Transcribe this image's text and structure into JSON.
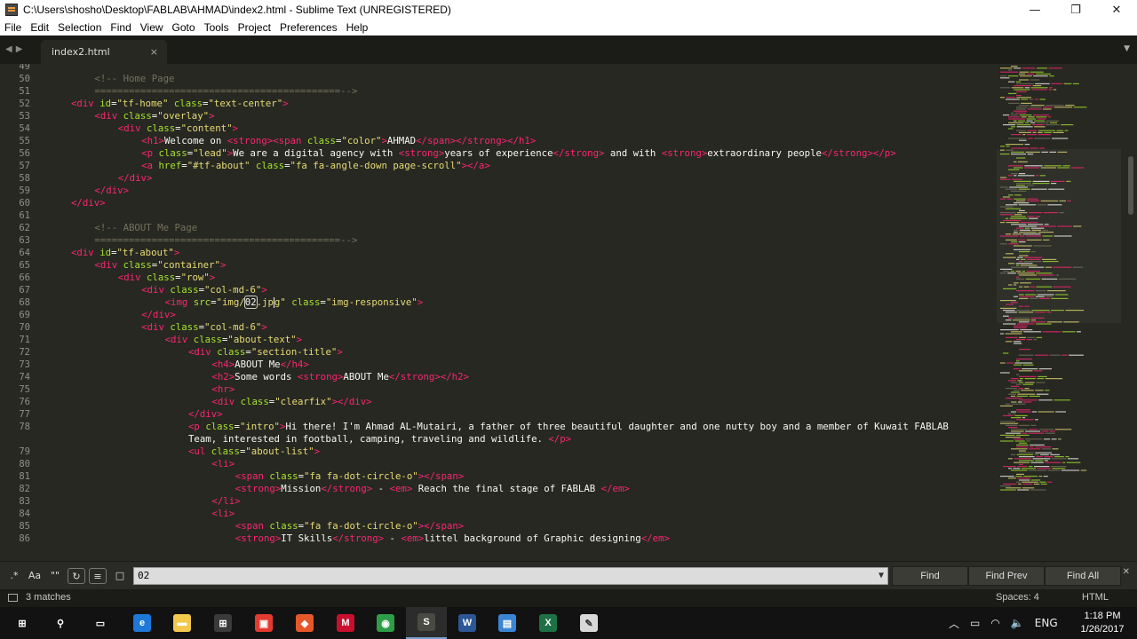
{
  "window": {
    "title": "C:\\Users\\shosho\\Desktop\\FABLAB\\AHMAD\\index2.html - Sublime Text (UNREGISTERED)",
    "controls": {
      "minimize": "—",
      "maximize": "❐",
      "close": "✕"
    }
  },
  "menu": [
    "File",
    "Edit",
    "Selection",
    "Find",
    "View",
    "Goto",
    "Tools",
    "Project",
    "Preferences",
    "Help"
  ],
  "tabs": [
    {
      "label": "index2.html",
      "close": "×",
      "active": true
    }
  ],
  "editor": {
    "first_visible_line": 49,
    "lines": [
      {
        "n": 49,
        "indent": 0,
        "tokens": []
      },
      {
        "n": 50,
        "indent": 1,
        "tokens": [
          [
            "com",
            "<!-- Home Page"
          ]
        ]
      },
      {
        "n": 51,
        "indent": 1,
        "tokens": [
          [
            "com",
            "===========================================-->"
          ]
        ]
      },
      {
        "n": 52,
        "indent": 0,
        "tokens": [
          [
            "tag",
            "<div "
          ],
          [
            "attr",
            "id"
          ],
          [
            "txt",
            "="
          ],
          [
            "str",
            "\"tf-home\""
          ],
          [
            "txt",
            " "
          ],
          [
            "attr",
            "class"
          ],
          [
            "txt",
            "="
          ],
          [
            "str",
            "\"text-center\""
          ],
          [
            "tag",
            ">"
          ]
        ]
      },
      {
        "n": 53,
        "indent": 1,
        "tokens": [
          [
            "tag",
            "<div "
          ],
          [
            "attr",
            "class"
          ],
          [
            "txt",
            "="
          ],
          [
            "str",
            "\"overlay\""
          ],
          [
            "tag",
            ">"
          ]
        ]
      },
      {
        "n": 54,
        "indent": 2,
        "tokens": [
          [
            "tag",
            "<div "
          ],
          [
            "attr",
            "class"
          ],
          [
            "txt",
            "="
          ],
          [
            "str",
            "\"content\""
          ],
          [
            "tag",
            ">"
          ]
        ]
      },
      {
        "n": 55,
        "indent": 3,
        "tokens": [
          [
            "tag",
            "<h1>"
          ],
          [
            "txt",
            "Welcome on "
          ],
          [
            "tag",
            "<strong>"
          ],
          [
            "tag",
            "<span "
          ],
          [
            "attr",
            "class"
          ],
          [
            "txt",
            "="
          ],
          [
            "str",
            "\"color\""
          ],
          [
            "tag",
            ">"
          ],
          [
            "txt",
            "AHMAD"
          ],
          [
            "tag",
            "</span>"
          ],
          [
            "tag",
            "</strong>"
          ],
          [
            "tag",
            "</h1>"
          ]
        ]
      },
      {
        "n": 56,
        "indent": 3,
        "tokens": [
          [
            "tag",
            "<p "
          ],
          [
            "attr",
            "class"
          ],
          [
            "txt",
            "="
          ],
          [
            "str",
            "\"lead\""
          ],
          [
            "tag",
            ">"
          ],
          [
            "txt",
            "We are a digital agency with "
          ],
          [
            "tag",
            "<strong>"
          ],
          [
            "txt",
            "years of experience"
          ],
          [
            "tag",
            "</strong>"
          ],
          [
            "txt",
            " and with "
          ],
          [
            "tag",
            "<strong>"
          ],
          [
            "txt",
            "extraordinary people"
          ],
          [
            "tag",
            "</strong>"
          ],
          [
            "tag",
            "</p>"
          ]
        ]
      },
      {
        "n": 57,
        "indent": 3,
        "tokens": [
          [
            "tag",
            "<a "
          ],
          [
            "attr",
            "href"
          ],
          [
            "txt",
            "="
          ],
          [
            "str",
            "\"#tf-about\""
          ],
          [
            "txt",
            " "
          ],
          [
            "attr",
            "class"
          ],
          [
            "txt",
            "="
          ],
          [
            "str",
            "\"fa fa-angle-down page-scroll\""
          ],
          [
            "tag",
            ">"
          ],
          [
            "tag",
            "</a>"
          ]
        ]
      },
      {
        "n": 58,
        "indent": 2,
        "tokens": [
          [
            "tag",
            "</div>"
          ]
        ]
      },
      {
        "n": 59,
        "indent": 1,
        "tokens": [
          [
            "tag",
            "</div>"
          ]
        ]
      },
      {
        "n": 60,
        "indent": 0,
        "tokens": [
          [
            "tag",
            "</div>"
          ]
        ]
      },
      {
        "n": 61,
        "indent": 0,
        "tokens": []
      },
      {
        "n": 62,
        "indent": 1,
        "tokens": [
          [
            "com",
            "<!-- ABOUT Me Page"
          ]
        ]
      },
      {
        "n": 63,
        "indent": 1,
        "tokens": [
          [
            "com",
            "===========================================-->"
          ]
        ]
      },
      {
        "n": 64,
        "indent": 0,
        "tokens": [
          [
            "tag",
            "<div "
          ],
          [
            "attr",
            "id"
          ],
          [
            "txt",
            "="
          ],
          [
            "str",
            "\"tf-about\""
          ],
          [
            "tag",
            ">"
          ]
        ]
      },
      {
        "n": 65,
        "indent": 1,
        "tokens": [
          [
            "tag",
            "<div "
          ],
          [
            "attr",
            "class"
          ],
          [
            "txt",
            "="
          ],
          [
            "str",
            "\"container\""
          ],
          [
            "tag",
            ">"
          ]
        ]
      },
      {
        "n": 66,
        "indent": 2,
        "tokens": [
          [
            "tag",
            "<div "
          ],
          [
            "attr",
            "class"
          ],
          [
            "txt",
            "="
          ],
          [
            "str",
            "\"row\""
          ],
          [
            "tag",
            ">"
          ]
        ]
      },
      {
        "n": 67,
        "indent": 3,
        "tokens": [
          [
            "tag",
            "<div "
          ],
          [
            "attr",
            "class"
          ],
          [
            "txt",
            "="
          ],
          [
            "str",
            "\"col-md-6\""
          ],
          [
            "tag",
            ">"
          ]
        ]
      },
      {
        "n": 68,
        "indent": 4,
        "tokens": [
          [
            "tag",
            "<img "
          ],
          [
            "attr",
            "src"
          ],
          [
            "txt",
            "="
          ],
          [
            "str",
            "\"img/"
          ],
          [
            "hl",
            "02"
          ],
          [
            "str",
            ".jp"
          ],
          [
            "cur",
            ""
          ],
          [
            "str",
            "g\""
          ],
          [
            "txt",
            " "
          ],
          [
            "attr",
            "class"
          ],
          [
            "txt",
            "="
          ],
          [
            "str",
            "\"img-responsive\""
          ],
          [
            "tag",
            ">"
          ]
        ]
      },
      {
        "n": 69,
        "indent": 3,
        "tokens": [
          [
            "tag",
            "</div>"
          ]
        ]
      },
      {
        "n": 70,
        "indent": 3,
        "tokens": [
          [
            "tag",
            "<div "
          ],
          [
            "attr",
            "class"
          ],
          [
            "txt",
            "="
          ],
          [
            "str",
            "\"col-md-6\""
          ],
          [
            "tag",
            ">"
          ]
        ]
      },
      {
        "n": 71,
        "indent": 4,
        "tokens": [
          [
            "tag",
            "<div "
          ],
          [
            "attr",
            "class"
          ],
          [
            "txt",
            "="
          ],
          [
            "str",
            "\"about-text\""
          ],
          [
            "tag",
            ">"
          ]
        ]
      },
      {
        "n": 72,
        "indent": 5,
        "tokens": [
          [
            "tag",
            "<div "
          ],
          [
            "attr",
            "class"
          ],
          [
            "txt",
            "="
          ],
          [
            "str",
            "\"section-title\""
          ],
          [
            "tag",
            ">"
          ]
        ]
      },
      {
        "n": 73,
        "indent": 6,
        "tokens": [
          [
            "tag",
            "<h4>"
          ],
          [
            "txt",
            "ABOUT Me"
          ],
          [
            "tag",
            "</h4>"
          ]
        ]
      },
      {
        "n": 74,
        "indent": 6,
        "tokens": [
          [
            "tag",
            "<h2>"
          ],
          [
            "txt",
            "Some words "
          ],
          [
            "tag",
            "<strong>"
          ],
          [
            "txt",
            "ABOUT Me"
          ],
          [
            "tag",
            "</strong>"
          ],
          [
            "tag",
            "</h2>"
          ]
        ]
      },
      {
        "n": 75,
        "indent": 6,
        "tokens": [
          [
            "tag",
            "<hr>"
          ]
        ]
      },
      {
        "n": 76,
        "indent": 6,
        "tokens": [
          [
            "tag",
            "<div "
          ],
          [
            "attr",
            "class"
          ],
          [
            "txt",
            "="
          ],
          [
            "str",
            "\"clearfix\""
          ],
          [
            "tag",
            ">"
          ],
          [
            "tag",
            "</div>"
          ]
        ]
      },
      {
        "n": 77,
        "indent": 5,
        "tokens": [
          [
            "tag",
            "</div>"
          ]
        ]
      },
      {
        "n": 78,
        "indent": 5,
        "tokens": [
          [
            "tag",
            "<p "
          ],
          [
            "attr",
            "class"
          ],
          [
            "txt",
            "="
          ],
          [
            "str",
            "\"intro\""
          ],
          [
            "tag",
            ">"
          ],
          [
            "txt",
            "Hi there! I'm Ahmad AL-Mutairi, a father of three beautiful daughter and one nutty boy and a member of Kuwait FABLAB"
          ]
        ]
      },
      {
        "n": null,
        "indent": 5,
        "tokens": [
          [
            "txt",
            "Team, interested in football, camping, traveling and wildlife. "
          ],
          [
            "tag",
            "</p>"
          ]
        ]
      },
      {
        "n": 79,
        "indent": 5,
        "tokens": [
          [
            "tag",
            "<ul "
          ],
          [
            "attr",
            "class"
          ],
          [
            "txt",
            "="
          ],
          [
            "str",
            "\"about-list\""
          ],
          [
            "tag",
            ">"
          ]
        ]
      },
      {
        "n": 80,
        "indent": 6,
        "tokens": [
          [
            "tag",
            "<li>"
          ]
        ]
      },
      {
        "n": 81,
        "indent": 7,
        "tokens": [
          [
            "tag",
            "<span "
          ],
          [
            "attr",
            "class"
          ],
          [
            "txt",
            "="
          ],
          [
            "str",
            "\"fa fa-dot-circle-o\""
          ],
          [
            "tag",
            ">"
          ],
          [
            "tag",
            "</span>"
          ]
        ]
      },
      {
        "n": 82,
        "indent": 7,
        "tokens": [
          [
            "tag",
            "<strong>"
          ],
          [
            "txt",
            "Mission"
          ],
          [
            "tag",
            "</strong>"
          ],
          [
            "txt",
            " - "
          ],
          [
            "tag",
            "<em>"
          ],
          [
            "txt",
            " Reach the final stage of FABLAB "
          ],
          [
            "tag",
            "</em>"
          ]
        ]
      },
      {
        "n": 83,
        "indent": 6,
        "tokens": [
          [
            "tag",
            "</li>"
          ]
        ]
      },
      {
        "n": 84,
        "indent": 6,
        "tokens": [
          [
            "tag",
            "<li>"
          ]
        ]
      },
      {
        "n": 85,
        "indent": 7,
        "tokens": [
          [
            "tag",
            "<span "
          ],
          [
            "attr",
            "class"
          ],
          [
            "txt",
            "="
          ],
          [
            "str",
            "\"fa fa-dot-circle-o\""
          ],
          [
            "tag",
            ">"
          ],
          [
            "tag",
            "</span>"
          ]
        ]
      },
      {
        "n": 86,
        "indent": 7,
        "tokens": [
          [
            "tag",
            "<strong>"
          ],
          [
            "txt",
            "IT Skills"
          ],
          [
            "tag",
            "</strong>"
          ],
          [
            "txt",
            " - "
          ],
          [
            "tag",
            "<em>"
          ],
          [
            "txt",
            "littel background of Graphic designing"
          ],
          [
            "tag",
            "</em>"
          ]
        ]
      }
    ]
  },
  "find_panel": {
    "options": {
      "regex": ".*",
      "case": "Aa",
      "whole_word": "\"\"",
      "wrap": "↻",
      "in_selection": "≡",
      "highlight": "□"
    },
    "query": "02",
    "dropdown": "▼",
    "buttons": {
      "find": "Find",
      "find_prev": "Find Prev",
      "find_all": "Find All"
    },
    "close": "✕"
  },
  "status": {
    "matches": "3 matches",
    "spaces": "Spaces: 4",
    "syntax": "HTML"
  },
  "taskbar": {
    "apps": [
      {
        "name": "windows-start",
        "glyph": "⊞",
        "color": "#121212"
      },
      {
        "name": "search",
        "glyph": "⚲",
        "color": "#121212"
      },
      {
        "name": "task-view",
        "glyph": "▭",
        "color": "#121212"
      },
      {
        "name": "edge",
        "glyph": "e",
        "color": "#1e78d7"
      },
      {
        "name": "file-explorer",
        "glyph": "▬",
        "color": "#f2c94c"
      },
      {
        "name": "store",
        "glyph": "⊞",
        "color": "#3a3a3a"
      },
      {
        "name": "app-red",
        "glyph": "▣",
        "color": "#e23b30"
      },
      {
        "name": "app-orange",
        "glyph": "◆",
        "color": "#e5582a"
      },
      {
        "name": "mcafee",
        "glyph": "M",
        "color": "#c8102e"
      },
      {
        "name": "chrome",
        "glyph": "◉",
        "color": "#2e9d48"
      },
      {
        "name": "sublime",
        "glyph": "S",
        "color": "#4a4a44"
      },
      {
        "name": "word",
        "glyph": "W",
        "color": "#2b5797"
      },
      {
        "name": "file-app",
        "glyph": "▤",
        "color": "#3a86d4"
      },
      {
        "name": "excel",
        "glyph": "X",
        "color": "#1e7145"
      },
      {
        "name": "paint",
        "glyph": "✎",
        "color": "#d8d8d8"
      }
    ],
    "active_app": "sublime",
    "tray": {
      "chevron": "︿",
      "battery": "▭",
      "wifi": "◠",
      "volume": "🔈",
      "language": "ENG",
      "notifications": "▢"
    },
    "time": "1:18 PM",
    "date": "1/26/2017"
  },
  "colors": {
    "editor_bg": "#272822",
    "tag": "#f92672",
    "attr": "#a6e22e",
    "string": "#e6db74",
    "comment": "#75715e",
    "text": "#f8f8f2"
  }
}
